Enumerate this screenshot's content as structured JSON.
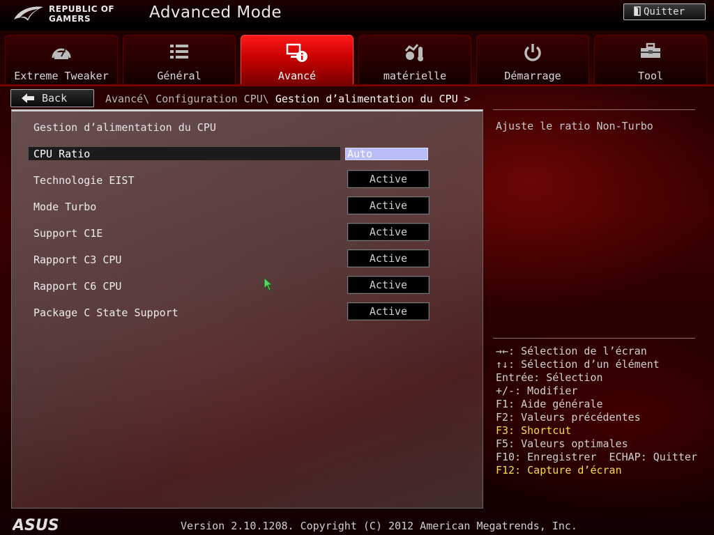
{
  "header": {
    "logo_line1": "REPUBLIC OF",
    "logo_line2": "GAMERS",
    "title": "Advanced Mode",
    "quit_label": "Quitter"
  },
  "tabs": [
    {
      "label": "Extreme Tweaker",
      "icon": "gauge-icon",
      "active": false
    },
    {
      "label": "Général",
      "icon": "list-icon",
      "active": false
    },
    {
      "label": "Avancé",
      "icon": "advanced-info-icon",
      "active": true
    },
    {
      "label": "matérielle",
      "icon": "hardware-monitor-icon",
      "active": false
    },
    {
      "label": "Démarrage",
      "icon": "power-icon",
      "active": false
    },
    {
      "label": "Tool",
      "icon": "toolbox-icon",
      "active": false
    }
  ],
  "nav": {
    "back_label": "Back",
    "breadcrumb": [
      "Avancé\\ ",
      "Configuration CPU\\ "
    ],
    "breadcrumb_current": "Gestion d’alimentation du CPU >"
  },
  "panel": {
    "section_title": "Gestion d’alimentation du CPU",
    "settings": [
      {
        "label": "CPU Ratio",
        "value": "Auto",
        "type": "input",
        "selected": true
      },
      {
        "label": "Technologie EIST",
        "value": "Active",
        "type": "option"
      },
      {
        "label": "Mode Turbo",
        "value": "Active",
        "type": "option"
      },
      {
        "label": "Support C1E",
        "value": "Active",
        "type": "option"
      },
      {
        "label": "Rapport C3 CPU",
        "value": "Active",
        "type": "option"
      },
      {
        "label": "Rapport C6 CPU",
        "value": "Active",
        "type": "option"
      },
      {
        "label": "Package C State Support",
        "value": "Active",
        "type": "option"
      }
    ]
  },
  "help": {
    "description": "Ajuste le ratio Non-Turbo",
    "keys": [
      {
        "text": "→←: Sélection de l’écran",
        "highlight": false
      },
      {
        "text": "↑↓: Sélection d’un élément",
        "highlight": false
      },
      {
        "text": "Entrée: Sélection",
        "highlight": false
      },
      {
        "text": "+/-: Modifier",
        "highlight": false
      },
      {
        "text": "F1: Aide générale",
        "highlight": false
      },
      {
        "text": "F2: Valeurs précédentes",
        "highlight": false
      },
      {
        "text": "F3: Shortcut",
        "highlight": true
      },
      {
        "text": "F5: Valeurs optimales",
        "highlight": false
      },
      {
        "text": "F10: Enregistrer  ECHAP: Quitter",
        "highlight": false
      },
      {
        "text": "F12: Capture d’écran",
        "highlight": true
      }
    ]
  },
  "footer": {
    "brand": "ASUS",
    "version": "Version 2.10.1208. Copyright (C) 2012 American Megatrends, Inc."
  },
  "colors": {
    "accent_red": "#d00000",
    "highlight_yellow": "#ffd84a",
    "input_fill": "#b9bdf8"
  }
}
